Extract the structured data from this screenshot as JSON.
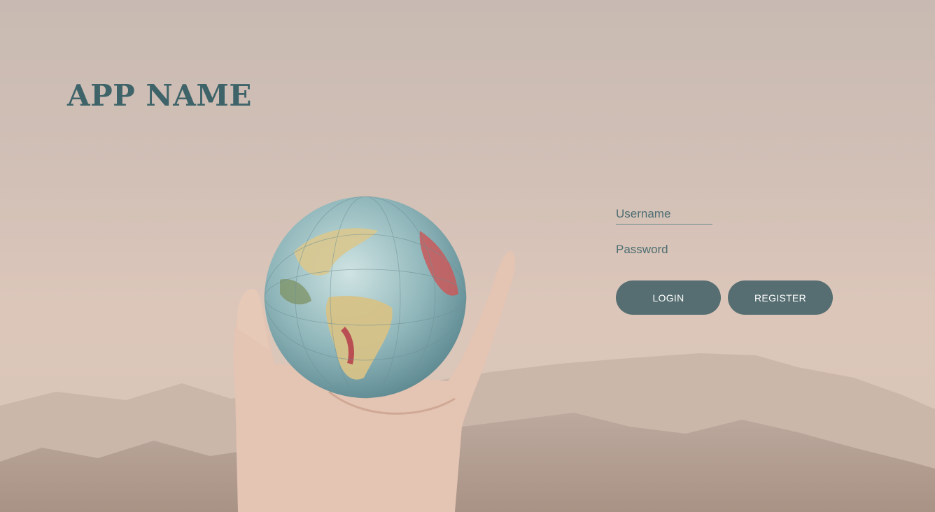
{
  "app": {
    "title": "APP NAME"
  },
  "login": {
    "username_placeholder": "Username",
    "password_placeholder": "Password",
    "login_label": "LOGIN",
    "register_label": "REGISTER"
  },
  "colors": {
    "accent": "#3e6469",
    "button": "#566e71",
    "button_text": "#ffffff"
  }
}
